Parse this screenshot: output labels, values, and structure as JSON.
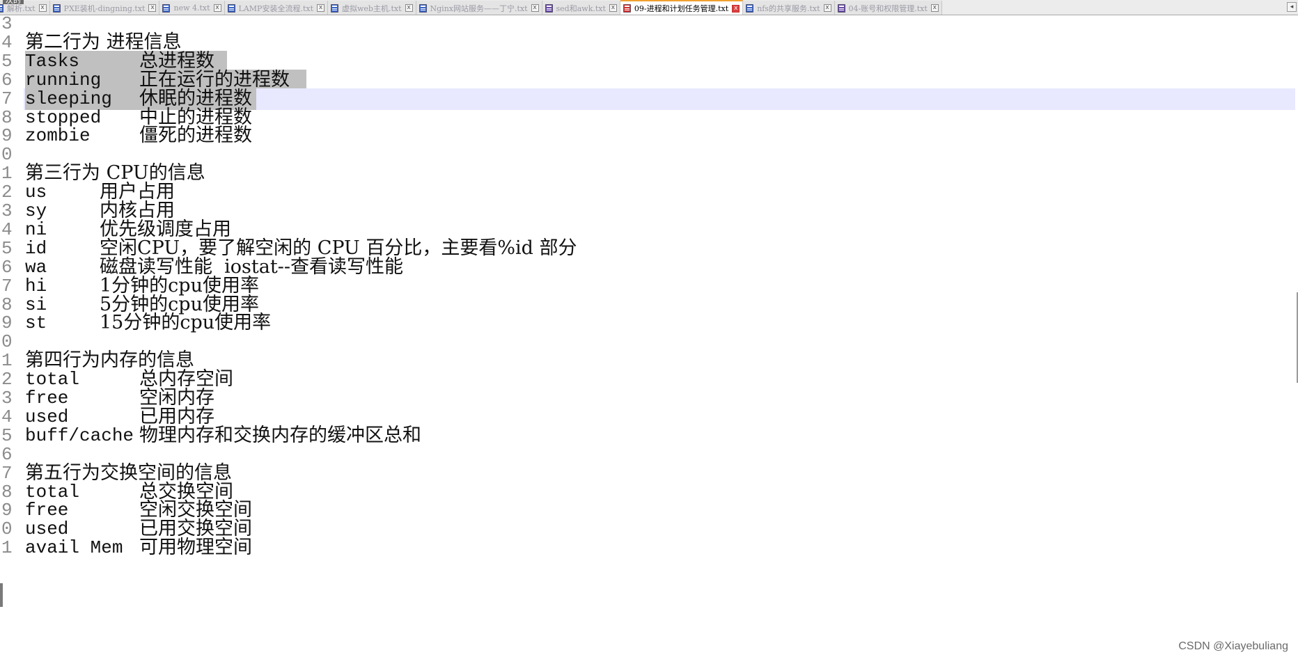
{
  "tabs": [
    {
      "label": "解析.txt",
      "active": false,
      "icon": "file-blue-icon"
    },
    {
      "label": "PXE装机-dingning.txt",
      "active": false,
      "icon": "file-blue-icon"
    },
    {
      "label": "new 4.txt",
      "active": false,
      "icon": "file-blue-icon"
    },
    {
      "label": "LAMP安装全流程.txt",
      "active": false,
      "icon": "file-blue-icon"
    },
    {
      "label": "虚拟web主机.txt",
      "active": false,
      "icon": "file-blue-icon"
    },
    {
      "label": "Nginx网站服务——丁宁.txt",
      "active": false,
      "icon": "file-blue-icon"
    },
    {
      "label": "sed和awk.txt",
      "active": false,
      "icon": "file-purple-icon"
    },
    {
      "label": "09-进程和计划任务管理.txt",
      "active": true,
      "icon": "file-red-icon"
    },
    {
      "label": "nfs的共享服务.txt",
      "active": false,
      "icon": "file-blue-icon"
    },
    {
      "label": "04-账号和权限管理.txt",
      "active": false,
      "icon": "file-purple-icon"
    }
  ],
  "tab_close_glyph": "x",
  "tab_scroll_glyph": "◂",
  "corner_label": "次的",
  "colors": {
    "active_tab_accent": "#f0a030",
    "selection": "#c0c0c0",
    "current_line": "#e8e8ff",
    "line_number": "#8c8c8c"
  },
  "lines": [
    {
      "num": "3",
      "kind": "blank"
    },
    {
      "num": "4",
      "kind": "heading",
      "text": "第二行为 进程信息"
    },
    {
      "num": "5",
      "kind": "pair",
      "key": "Tasks",
      "desc": "总进程数",
      "col": 200,
      "selected": true,
      "sel_width": 290
    },
    {
      "num": "6",
      "kind": "pair",
      "key": "running",
      "desc": "正在运行的进程数",
      "col": 200,
      "selected": true,
      "sel_width": 404
    },
    {
      "num": "7",
      "kind": "pair",
      "key": "sleeping",
      "desc": "休眠的进程数",
      "col": 200,
      "selected": true,
      "sel_width": 332,
      "current": true
    },
    {
      "num": "8",
      "kind": "pair",
      "key": "stopped",
      "desc": "中止的进程数",
      "col": 200
    },
    {
      "num": "9",
      "kind": "pair",
      "key": "zombie",
      "desc": "僵死的进程数",
      "col": 200
    },
    {
      "num": "0",
      "kind": "blank"
    },
    {
      "num": "1",
      "kind": "heading",
      "text": "第三行为 CPU的信息"
    },
    {
      "num": "2",
      "kind": "pair",
      "key": "us",
      "desc": "用户占用",
      "col": 143
    },
    {
      "num": "3",
      "kind": "pair",
      "key": "sy",
      "desc": "内核占用",
      "col": 143
    },
    {
      "num": "4",
      "kind": "pair",
      "key": "ni",
      "desc": "优先级调度占用",
      "col": 143
    },
    {
      "num": "5",
      "kind": "pair",
      "key": "id",
      "desc": "空闲CPU，要了解空闲的 CPU 百分比，主要看%id 部分",
      "col": 143
    },
    {
      "num": "6",
      "kind": "pair",
      "key": "wa",
      "desc": "磁盘读写性能  iostat--查看读写性能",
      "col": 143
    },
    {
      "num": "7",
      "kind": "pair",
      "key": "hi",
      "desc": "1分钟的cpu使用率",
      "col": 143
    },
    {
      "num": "8",
      "kind": "pair",
      "key": "si",
      "desc": "5分钟的cpu使用率",
      "col": 143
    },
    {
      "num": "9",
      "kind": "pair",
      "key": "st",
      "desc": "15分钟的cpu使用率",
      "col": 143
    },
    {
      "num": "0",
      "kind": "blank"
    },
    {
      "num": "1",
      "kind": "heading",
      "text": "第四行为内存的信息"
    },
    {
      "num": "2",
      "kind": "pair",
      "key": "total",
      "desc": "总内存空间",
      "col": 200
    },
    {
      "num": "3",
      "kind": "pair",
      "key": "free",
      "desc": "空闲内存",
      "col": 200
    },
    {
      "num": "4",
      "kind": "pair",
      "key": "used",
      "desc": "已用内存",
      "col": 200
    },
    {
      "num": "5",
      "kind": "pair",
      "key": "buff/cache",
      "desc": "物理内存和交换内存的缓冲区总和",
      "col": 200
    },
    {
      "num": "6",
      "kind": "blank"
    },
    {
      "num": "7",
      "kind": "heading",
      "text": "第五行为交换空间的信息"
    },
    {
      "num": "8",
      "kind": "pair",
      "key": "total",
      "desc": "总交换空间",
      "col": 200
    },
    {
      "num": "9",
      "kind": "pair",
      "key": "free",
      "desc": "空闲交换空间",
      "col": 200
    },
    {
      "num": "0",
      "kind": "pair",
      "key": "used",
      "desc": "已用交换空间",
      "col": 200
    },
    {
      "num": "1",
      "kind": "pair",
      "key": "avail Mem",
      "desc": "可用物理空间",
      "col": 200
    }
  ],
  "watermark": "CSDN @Xiayebuliang"
}
